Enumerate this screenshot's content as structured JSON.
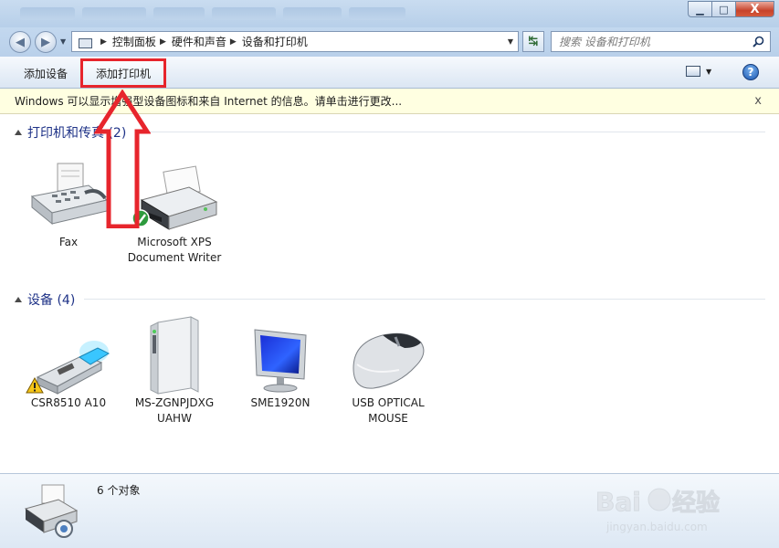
{
  "window": {
    "controls": {
      "minimize": "▁",
      "maximize": "□",
      "close": "X"
    }
  },
  "nav": {
    "back": "◀",
    "forward": "▶",
    "breadcrumbs": [
      "控制面板",
      "硬件和声音",
      "设备和打印机"
    ],
    "search_placeholder": "搜索 设备和打印机"
  },
  "commands": {
    "add_device": "添加设备",
    "add_printer": "添加打印机"
  },
  "infobar": {
    "message": "Windows 可以显示增强型设备图标和来自 Internet 的信息。请单击进行更改...",
    "close": "x"
  },
  "groups": [
    {
      "title": "打印机和传真 (2)"
    },
    {
      "title": "设备 (4)"
    }
  ],
  "printers": [
    {
      "name": "Fax",
      "icon": "fax-icon"
    },
    {
      "name": "Microsoft XPS Document Writer",
      "icon": "printer-icon",
      "default": true
    }
  ],
  "devices": [
    {
      "name": "CSR8510 A10",
      "icon": "usb-dongle-icon",
      "warning": true
    },
    {
      "name": "MS-ZGNPJDXG UAHW",
      "icon": "computer-tower-icon"
    },
    {
      "name": "SME1920N",
      "icon": "monitor-icon"
    },
    {
      "name": "USB OPTICAL MOUSE",
      "icon": "mouse-icon"
    }
  ],
  "details": {
    "count": "6 个对象"
  },
  "watermark": {
    "brand": "Baidu经验",
    "url": "jingyan.baidu.com"
  },
  "colors": {
    "highlight": "#e7252c",
    "group_title": "#1e3287",
    "infobar_bg": "#ffffe1"
  }
}
